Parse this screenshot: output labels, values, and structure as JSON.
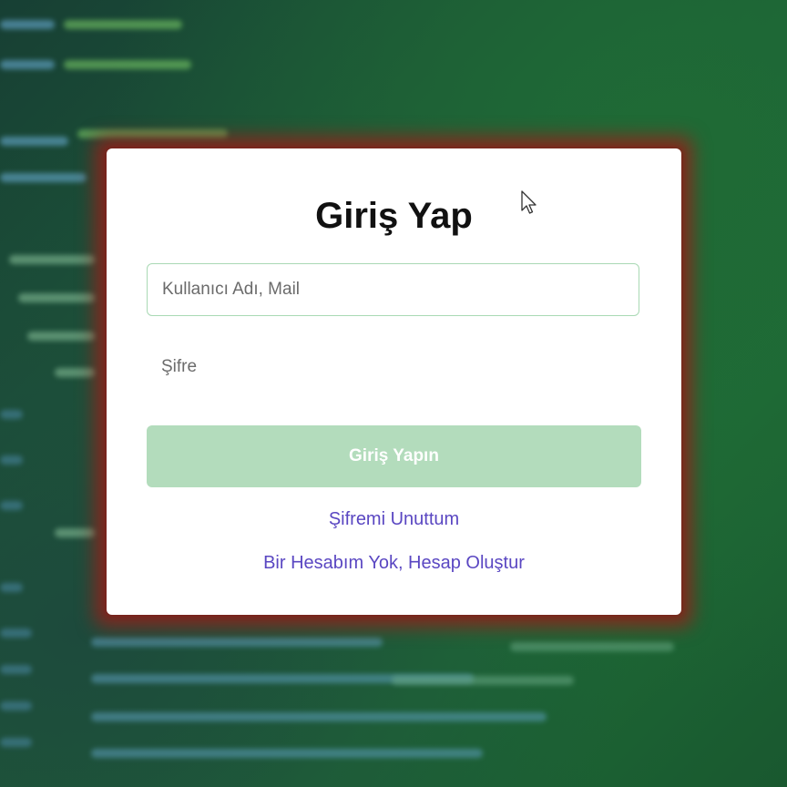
{
  "login": {
    "title": "Giriş Yap",
    "username_placeholder": "Kullanıcı Adı, Mail",
    "password_placeholder": "Şifre",
    "submit_label": "Giriş Yapın",
    "forgot_password_link": "Şifremi Unuttum",
    "register_link": "Bir Hesabım Yok, Hesap Oluştur"
  },
  "colors": {
    "accent_green": "#b3dcbc",
    "input_border": "#a9d9b4",
    "link_color": "#5a47c2",
    "card_glow": "#961e19",
    "background": "#1d5a38"
  },
  "icons": {
    "pointer": "mouse-pointer-icon"
  }
}
